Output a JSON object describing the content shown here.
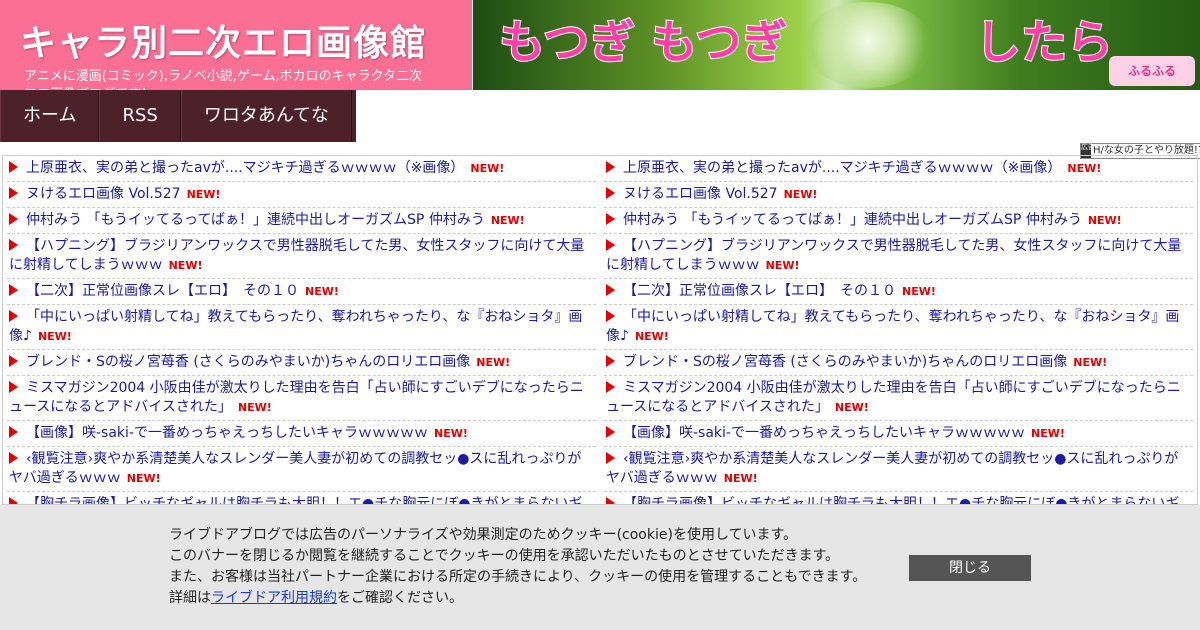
{
  "header": {
    "title": "キャラ別二次エロ画像館",
    "description": "アニメに漫画(コミック),ラノベ小説,ゲーム,ボカロのキャラクタ二次エロ画像ブログです！",
    "bg_color": "#fb6f95"
  },
  "banner": {
    "text_left": "もつぎ もつぎ",
    "text_right": "したら",
    "logo": "ふるふる"
  },
  "nav": [
    {
      "label": "ホーム"
    },
    {
      "label": "RSS"
    },
    {
      "label": "ワロタあんてな"
    }
  ],
  "ad_note": {
    "mark": "広告",
    "text": "H/な女の子とやり放題!?"
  },
  "new_label": "NEW!",
  "list_left": [
    {
      "title": "上原亜衣、実の弟と撮ったavが....マジキチ過ぎるｗｗｗｗ（※画像）"
    },
    {
      "title": "ヌけるエロ画像 Vol.527"
    },
    {
      "title": "仲村みう 「もうイッてるってばぁ！」連続中出しオーガズムSP 仲村みう"
    },
    {
      "title": "【ハプニング】ブラジリアンワックスで男性器脱毛してた男、女性スタッフに向けて大量に射精してしまうｗｗｗ"
    },
    {
      "title": "【二次】正常位画像スレ【エロ】　その１０"
    },
    {
      "title": "「中にいっぱい射精してね」教えてもらったり、奪われちゃったり、な『おねショタ』画像♪"
    },
    {
      "title": "ブレンド・Sの桜ノ宮苺香 (さくらのみやまいか)ちゃんのロリエロ画像"
    },
    {
      "title": "ミスマガジン2004 小阪由佳が激太りした理由を告白「占い師にすごいデブになったらニュースになるとアドバイスされた」"
    },
    {
      "title": "【画像】咲-saki-で一番めっちゃえっちしたいキャラｗｗｗｗｗ"
    },
    {
      "title": "‹観覧注意›爽やか系清楚美人なスレンダー美人妻が初めての調教セッ●スに乱れっぷりがヤバ過ぎるｗｗｗ"
    },
    {
      "title": "【胸チラ画像】ビッチなギャルは胸チラも大胆！！エ●チな胸元にぼ●きがとまらないギャルの胸チラ画像"
    }
  ],
  "list_right": [
    {
      "title": "上原亜衣、実の弟と撮ったavが....マジキチ過ぎるｗｗｗｗ（※画像）"
    },
    {
      "title": "ヌけるエロ画像 Vol.527"
    },
    {
      "title": "仲村みう 「もうイッてるってばぁ！」連続中出しオーガズムSP 仲村みう"
    },
    {
      "title": "【ハプニング】ブラジリアンワックスで男性器脱毛してた男、女性スタッフに向けて大量に射精してしまうｗｗｗ"
    },
    {
      "title": "【二次】正常位画像スレ【エロ】　その１０"
    },
    {
      "title": "「中にいっぱい射精してね」教えてもらったり、奪われちゃったり、な『おねショタ』画像♪"
    },
    {
      "title": "ブレンド・Sの桜ノ宮苺香 (さくらのみやまいか)ちゃんのロリエロ画像"
    },
    {
      "title": "ミスマガジン2004 小阪由佳が激太りした理由を告白「占い師にすごいデブになったらニュースになるとアドバイスされた」"
    },
    {
      "title": "【画像】咲-saki-で一番めっちゃえっちしたいキャラｗｗｗｗｗ"
    },
    {
      "title": "‹観覧注意›爽やか系清楚美人なスレンダー美人妻が初めての調教セッ●スに乱れっぷりがヤバ過ぎるｗｗｗ"
    },
    {
      "title": "【胸チラ画像】ビッチなギャルは胸チラも大胆！！エ●チな胸元にぼ●きがとまらないギャルの胸チラ画像"
    }
  ],
  "cookie": {
    "line1": "ライブドアブログでは広告のパーソナライズや効果測定のためクッキー(cookie)を使用しています。",
    "line2": "このバナーを閉じるか閲覧を継続することでクッキーの使用を承認いただいたものとさせていただきます。",
    "line3": "また、お客様は当社パートナー企業における所定の手続きにより、クッキーの使用を管理することもできます。",
    "line4_prefix": "詳細は",
    "link": "ライブドア利用規約",
    "line4_suffix": "をご確認ください。",
    "close_label": "閉じる"
  }
}
